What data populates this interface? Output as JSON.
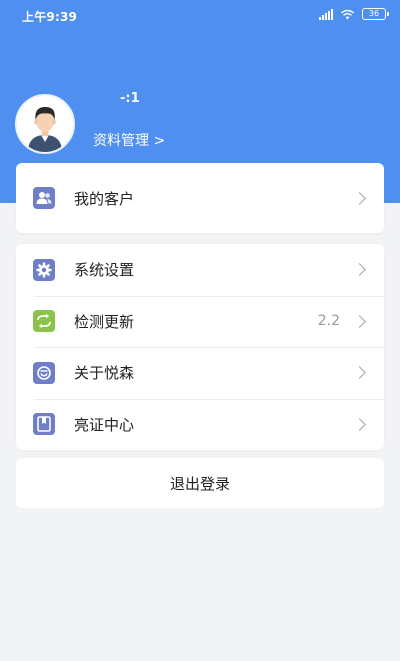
{
  "status_bar": {
    "time": "上午9:39",
    "battery": "36"
  },
  "profile": {
    "name": "-:1",
    "manage_link": "资料管理 >"
  },
  "section_customers": [
    {
      "label": "我的客户",
      "icon": "customers-icon",
      "icon_color": "#6f7fc7"
    }
  ],
  "section_menu": [
    {
      "label": "系统设置",
      "icon": "gear-icon",
      "icon_color": "#6f7fc7",
      "value": ""
    },
    {
      "label": "检测更新",
      "icon": "refresh-icon",
      "icon_color": "#8cc34a",
      "value": "2.2"
    },
    {
      "label": "关于悦森",
      "icon": "about-icon",
      "icon_color": "#6f7fc7",
      "value": ""
    },
    {
      "label": "亮证中心",
      "icon": "certificate-icon",
      "icon_color": "#6f7fc7",
      "value": ""
    }
  ],
  "logout": {
    "label": "退出登录"
  },
  "colors": {
    "header": "#4f8ff0",
    "background": "#f2f3f5"
  }
}
